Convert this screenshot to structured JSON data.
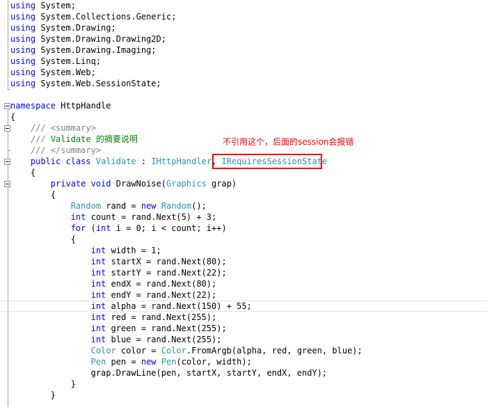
{
  "annotation": {
    "text": "不引用这个，后面的session会报错"
  },
  "colors": {
    "keyword": "#0000ff",
    "type": "#2b91af",
    "comment": "#008000",
    "doc_tag": "#808080",
    "annotation": "#ff0000"
  },
  "lines": [
    [
      [
        "kw",
        "using"
      ],
      [
        "t",
        " System;"
      ]
    ],
    [
      [
        "kw",
        "using"
      ],
      [
        "t",
        " System.Collections.Generic;"
      ]
    ],
    [
      [
        "kw",
        "using"
      ],
      [
        "t",
        " System.Drawing;"
      ]
    ],
    [
      [
        "kw",
        "using"
      ],
      [
        "t",
        " System.Drawing.Drawing2D;"
      ]
    ],
    [
      [
        "kw",
        "using"
      ],
      [
        "t",
        " System.Drawing.Imaging;"
      ]
    ],
    [
      [
        "kw",
        "using"
      ],
      [
        "t",
        " System.Linq;"
      ]
    ],
    [
      [
        "kw",
        "using"
      ],
      [
        "t",
        " System.Web;"
      ]
    ],
    [
      [
        "kw",
        "using"
      ],
      [
        "t",
        " System.Web.SessionState;"
      ]
    ],
    [],
    [
      [
        "kw",
        "namespace"
      ],
      [
        "t",
        " HttpHandle"
      ]
    ],
    [
      [
        "t",
        "{"
      ]
    ],
    [
      [
        "t",
        "    "
      ],
      [
        "dc",
        "///"
      ],
      [
        "cm",
        " "
      ],
      [
        "dc",
        "<summary>"
      ]
    ],
    [
      [
        "t",
        "    "
      ],
      [
        "dc",
        "///"
      ],
      [
        "cm",
        " Validate 的摘要说明"
      ]
    ],
    [
      [
        "t",
        "    "
      ],
      [
        "dc",
        "///"
      ],
      [
        "cm",
        " "
      ],
      [
        "dc",
        "</summary>"
      ]
    ],
    [
      [
        "t",
        "    "
      ],
      [
        "kw",
        "public"
      ],
      [
        "t",
        " "
      ],
      [
        "kw",
        "class"
      ],
      [
        "t",
        " "
      ],
      [
        "ty",
        "Validate"
      ],
      [
        "t",
        " : "
      ],
      [
        "ty",
        "IHttpHandler"
      ],
      [
        "t",
        ", "
      ],
      [
        "ty",
        "IRequiresSessionState"
      ]
    ],
    [
      [
        "t",
        "    {"
      ]
    ],
    [
      [
        "t",
        "        "
      ],
      [
        "kw",
        "private"
      ],
      [
        "t",
        " "
      ],
      [
        "kw",
        "void"
      ],
      [
        "t",
        " DrawNoise("
      ],
      [
        "ty",
        "Graphics"
      ],
      [
        "t",
        " grap)"
      ]
    ],
    [
      [
        "t",
        "        {"
      ]
    ],
    [
      [
        "t",
        "            "
      ],
      [
        "ty",
        "Random"
      ],
      [
        "t",
        " rand = "
      ],
      [
        "kw",
        "new"
      ],
      [
        "t",
        " "
      ],
      [
        "ty",
        "Random"
      ],
      [
        "t",
        "();"
      ]
    ],
    [
      [
        "t",
        "            "
      ],
      [
        "kw",
        "int"
      ],
      [
        "t",
        " count = rand.Next(5) + 3;"
      ]
    ],
    [
      [
        "t",
        "            "
      ],
      [
        "kw",
        "for"
      ],
      [
        "t",
        " ("
      ],
      [
        "kw",
        "int"
      ],
      [
        "t",
        " i = 0; i < count; i++)"
      ]
    ],
    [
      [
        "t",
        "            {"
      ]
    ],
    [
      [
        "t",
        "                "
      ],
      [
        "kw",
        "int"
      ],
      [
        "t",
        " width = 1;"
      ]
    ],
    [
      [
        "t",
        "                "
      ],
      [
        "kw",
        "int"
      ],
      [
        "t",
        " startX = rand.Next(80);"
      ]
    ],
    [
      [
        "t",
        "                "
      ],
      [
        "kw",
        "int"
      ],
      [
        "t",
        " startY = rand.Next(22);"
      ]
    ],
    [
      [
        "t",
        "                "
      ],
      [
        "kw",
        "int"
      ],
      [
        "t",
        " endX = rand.Next(80);"
      ]
    ],
    [
      [
        "t",
        "                "
      ],
      [
        "kw",
        "int"
      ],
      [
        "t",
        " endY = rand.Next(22);"
      ]
    ],
    [
      [
        "t",
        "                "
      ],
      [
        "kw",
        "int"
      ],
      [
        "t",
        " alpha = rand.Next(150) + 55;"
      ]
    ],
    [
      [
        "t",
        "                "
      ],
      [
        "kw",
        "int"
      ],
      [
        "t",
        " red = rand.Next(255);"
      ]
    ],
    [
      [
        "t",
        "                "
      ],
      [
        "kw",
        "int"
      ],
      [
        "t",
        " green = rand.Next(255);"
      ]
    ],
    [
      [
        "t",
        "                "
      ],
      [
        "kw",
        "int"
      ],
      [
        "t",
        " blue = rand.Next(255);"
      ]
    ],
    [
      [
        "t",
        "                "
      ],
      [
        "ty",
        "Color"
      ],
      [
        "t",
        " color = "
      ],
      [
        "ty",
        "Color"
      ],
      [
        "t",
        ".FromArgb(alpha, red, green, blue);"
      ]
    ],
    [
      [
        "t",
        "                "
      ],
      [
        "ty",
        "Pen"
      ],
      [
        "t",
        " pen = "
      ],
      [
        "kw",
        "new"
      ],
      [
        "t",
        " "
      ],
      [
        "ty",
        "Pen"
      ],
      [
        "t",
        "(color, width);"
      ]
    ],
    [
      [
        "t",
        "                grap.DrawLine(pen, startX, startY, endX, endY);"
      ]
    ],
    [
      [
        "t",
        "            }"
      ]
    ],
    [
      [
        "t",
        "        }"
      ]
    ]
  ]
}
